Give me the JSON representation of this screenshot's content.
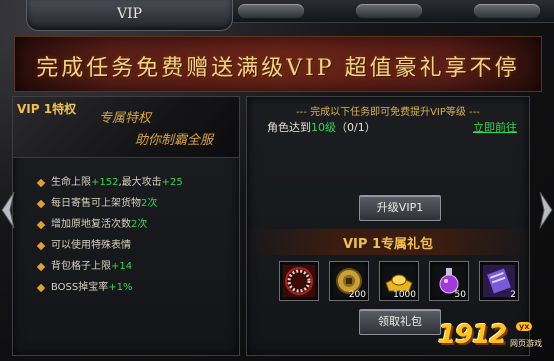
{
  "window": {
    "title": "VIP"
  },
  "banner": {
    "text": "完成任务免费赠送满级VIP  超值豪礼享不停"
  },
  "left_panel": {
    "vip_tag": "VIP 1特权",
    "slogan_line1": "专属特权",
    "slogan_line2": "助你制霸全服",
    "perks": [
      {
        "parts": [
          "生命上限",
          "+152",
          ",最大攻击",
          "+25"
        ]
      },
      {
        "parts": [
          "每日寄售可上架货物",
          "2次"
        ]
      },
      {
        "parts": [
          "增加原地复活次数",
          "2次"
        ]
      },
      {
        "parts": [
          "可以使用特殊表情"
        ]
      },
      {
        "parts": [
          "背包格子上限",
          "+14"
        ]
      },
      {
        "parts": [
          "BOSS掉宝率",
          "+1%"
        ]
      }
    ]
  },
  "right_panel": {
    "task_header": "--- 完成以下任务即可免费提升VIP等级 ---",
    "task_prefix": "角色达到",
    "task_level": "10级",
    "task_progress": "（0/1）",
    "task_link": "立即前往",
    "upgrade_button": "升级VIP1",
    "gift_title": "VIP 1专属礼包",
    "gifts": [
      {
        "icon": "ring-icon",
        "qty": ""
      },
      {
        "icon": "coin-icon",
        "qty": "200"
      },
      {
        "icon": "gold-ingot-icon",
        "qty": "1000"
      },
      {
        "icon": "potion-icon",
        "qty": "50"
      },
      {
        "icon": "scroll-icon",
        "qty": "2"
      }
    ],
    "claim_button": "领取礼包"
  },
  "watermark": {
    "number": "1912",
    "badge": "yx",
    "sub": "网页游戏"
  },
  "colors": {
    "highlight": "#2fd84a",
    "gold": "#f2c04f",
    "banner_text": "#f3d28a"
  }
}
